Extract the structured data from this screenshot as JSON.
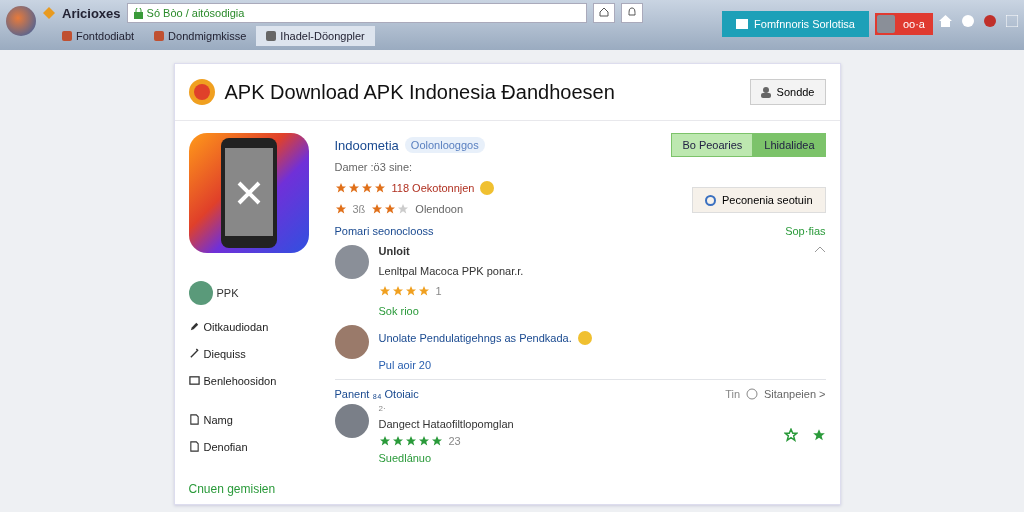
{
  "browser": {
    "app_name": "Aricioxes",
    "url": "Só Bòo / aitósodigia",
    "tabs": [
      {
        "label": "Fontdodiabt",
        "selected": false
      },
      {
        "label": "Dondmigmkisse",
        "selected": false
      },
      {
        "label": "Ihadel-Döongpler",
        "selected": true
      }
    ],
    "promo_button": "Fomfnnoris Sorlotisa",
    "user_button": "oo·a"
  },
  "header": {
    "title": "APK Download APK Indonesia Ðandhoesen",
    "button": "Sondde"
  },
  "app": {
    "name": "Indoometia",
    "tag": "Oolonlooggos",
    "meta": "Damer :ö3 sine:",
    "rating_1": {
      "stars": 4,
      "text": "118 Oekotonnjen"
    },
    "rating_2": {
      "prefix": "3ß",
      "stars": 2,
      "text": "Olendoon"
    },
    "segments": [
      {
        "label": "Bo Peoaries",
        "selected": false
      },
      {
        "label": "Lhidalidea",
        "selected": true
      }
    ],
    "secondary_button": "Peconenia seotuin"
  },
  "sidebar": {
    "profile": "PPK",
    "items": [
      {
        "label": "Oitkaudiodan",
        "kind": "pen"
      },
      {
        "label": "Diequiss",
        "kind": "wand"
      },
      {
        "label": "Benlehoosidon",
        "kind": "card"
      },
      {
        "label": "Namg",
        "kind": "doc"
      },
      {
        "label": "Denofian",
        "kind": "doc"
      }
    ],
    "footer": "Cnuen gemisien"
  },
  "reviews": {
    "label": "Pomari seonoclooss",
    "link": "Sop·fias",
    "first": {
      "author": "Unloit",
      "text": "Lenltpal Macoca PPK ponar.r.",
      "stars": 4,
      "count": "1",
      "meta": "Sok rioo"
    },
    "reply": {
      "text": "Unolate Pendulatigehngs as Pendkada.",
      "meta": "Pul aoir 20"
    }
  },
  "section_2": {
    "label": "Panent ₈₄ Otoiaic",
    "sort": "Tin",
    "filter": "Sitanpeien >",
    "comment": {
      "rank": "2·",
      "text": "Dangect Hataofiltlopomglan",
      "stars": 5,
      "count": "23",
      "status": "Suedlánuo"
    }
  }
}
